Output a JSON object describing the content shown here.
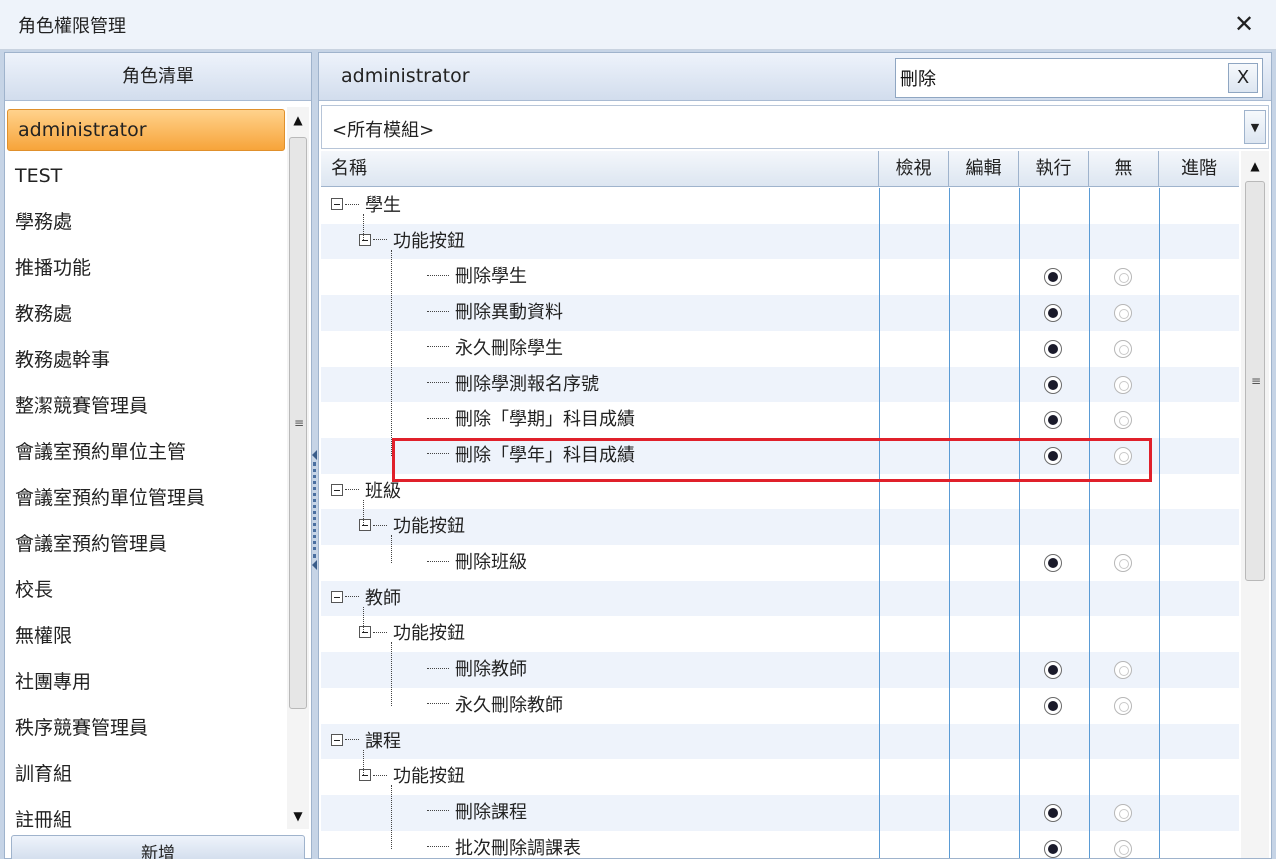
{
  "window": {
    "title": "角色權限管理",
    "close_label": "✕"
  },
  "left_panel": {
    "header": "角色清單",
    "roles": [
      "administrator",
      "TEST",
      "學務處",
      "推播功能",
      "教務處",
      "教務處幹事",
      "整潔競賽管理員",
      "會議室預約單位主管",
      "會議室預約單位管理員",
      "會議室預約管理員",
      "校長",
      "無權限",
      "社團專用",
      "秩序競賽管理員",
      "訓育組",
      "註冊組"
    ],
    "selected_index": 0,
    "new_button": "新增"
  },
  "right_panel": {
    "role_name": "administrator",
    "search": {
      "value": "刪除",
      "clear_label": "X"
    },
    "module_filter": "<所有模組>",
    "columns": {
      "name": "名稱",
      "view": "檢視",
      "edit": "編輯",
      "execute": "執行",
      "none": "無",
      "advanced": "進階"
    },
    "rows": [
      {
        "level": 0,
        "label": "學生"
      },
      {
        "level": 1,
        "label": "功能按鈕"
      },
      {
        "level": 2,
        "label": "刪除學生",
        "execute": true
      },
      {
        "level": 2,
        "label": "刪除異動資料",
        "execute": true
      },
      {
        "level": 2,
        "label": "永久刪除學生",
        "execute": true
      },
      {
        "level": 2,
        "label": "刪除學測報名序號",
        "execute": true
      },
      {
        "level": 2,
        "label": "刪除「學期」科目成績",
        "execute": true
      },
      {
        "level": 2,
        "label": "刪除「學年」科目成績",
        "execute": true,
        "highlighted": true
      },
      {
        "level": 0,
        "label": "班級"
      },
      {
        "level": 1,
        "label": "功能按鈕"
      },
      {
        "level": 2,
        "label": "刪除班級",
        "execute": true
      },
      {
        "level": 0,
        "label": "教師"
      },
      {
        "level": 1,
        "label": "功能按鈕"
      },
      {
        "level": 2,
        "label": "刪除教師",
        "execute": true
      },
      {
        "level": 2,
        "label": "永久刪除教師",
        "execute": true
      },
      {
        "level": 0,
        "label": "課程"
      },
      {
        "level": 1,
        "label": "功能按鈕"
      },
      {
        "level": 2,
        "label": "刪除課程",
        "execute": true
      },
      {
        "level": 2,
        "label": "批次刪除調課表",
        "execute": true
      }
    ]
  },
  "colors": {
    "accent_selected": "#f7a43a",
    "highlight_border": "#e0202a",
    "grid_line": "#5a9bd5"
  }
}
